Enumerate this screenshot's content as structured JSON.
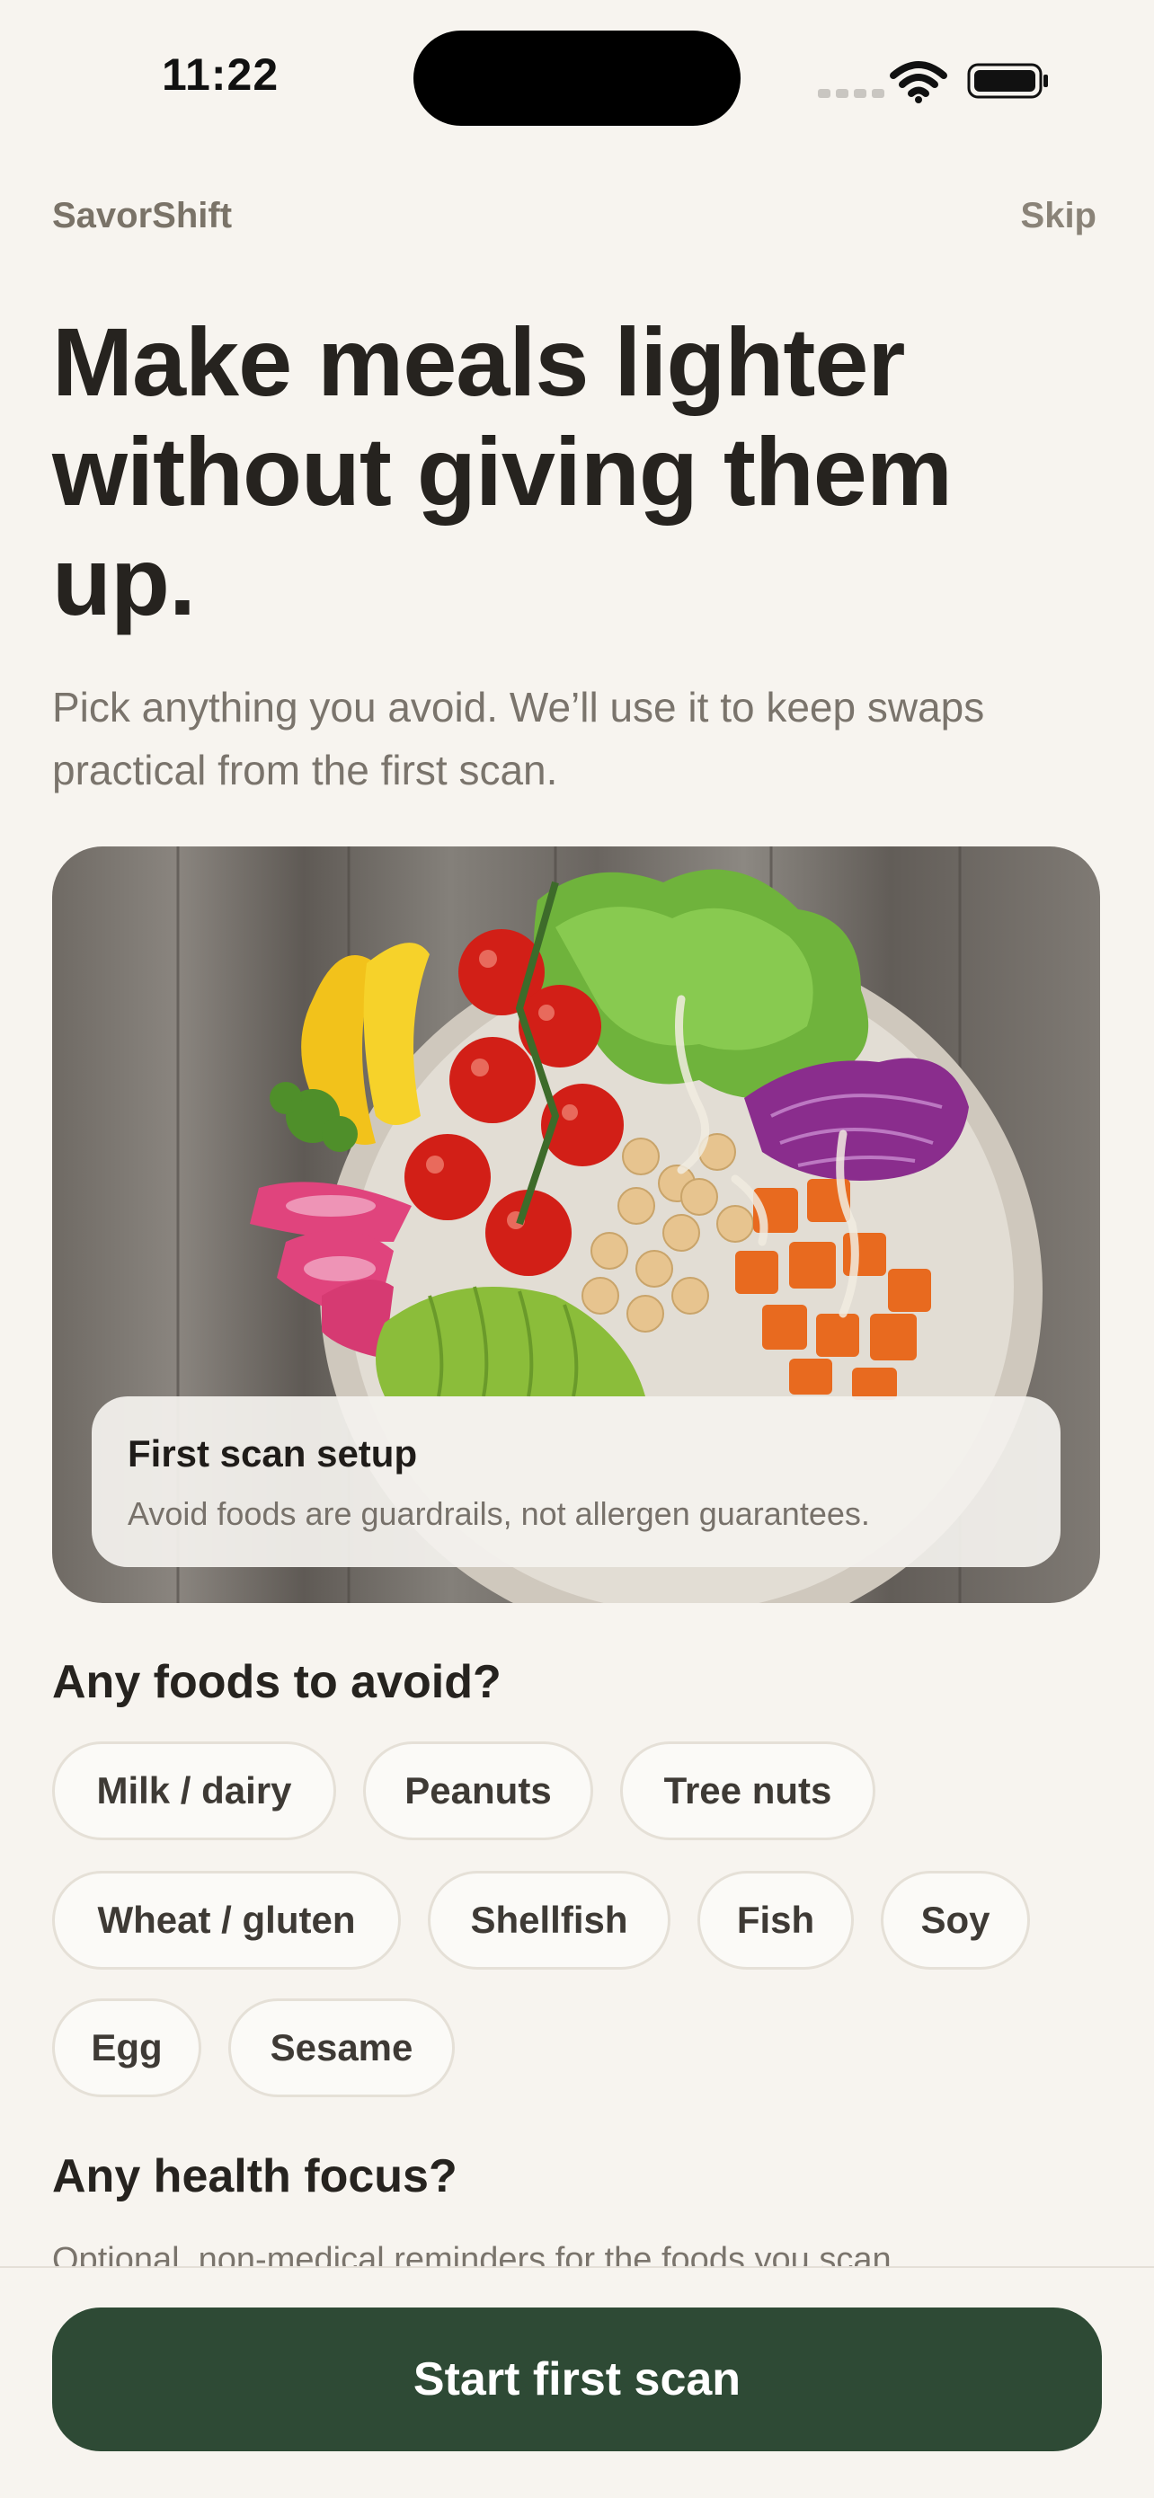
{
  "status_bar": {
    "time": "11:22",
    "wifi_icon": "wifi-icon",
    "battery_icon": "battery-icon"
  },
  "header": {
    "brand": "SavorShift",
    "skip_label": "Skip"
  },
  "headline": "Make meals lighter without giving them up.",
  "subtext": "Pick anything you avoid. We’ll use it to keep swaps practical from the first scan.",
  "hero": {
    "image": "salad bowl with tomatoes, greens, chickpeas, sweet potato, avocado and radish on wood",
    "card_title": "First scan setup",
    "card_text": "Avoid foods are guardrails, not allergen guarantees."
  },
  "avoid_section": {
    "title": "Any foods to avoid?",
    "options": [
      "Milk / dairy",
      "Peanuts",
      "Tree nuts",
      "Wheat / gluten",
      "Shellfish",
      "Fish",
      "Soy",
      "Egg",
      "Sesame"
    ]
  },
  "health_section": {
    "title": "Any health focus?",
    "note": "Optional, non-medical reminders for the foods you scan."
  },
  "footer": {
    "cta_label": "Start first scan"
  },
  "colors": {
    "background": "#f7f4ef",
    "accent": "#2e4a35",
    "chip_border": "#e5e0d7",
    "text": "#26231f"
  }
}
